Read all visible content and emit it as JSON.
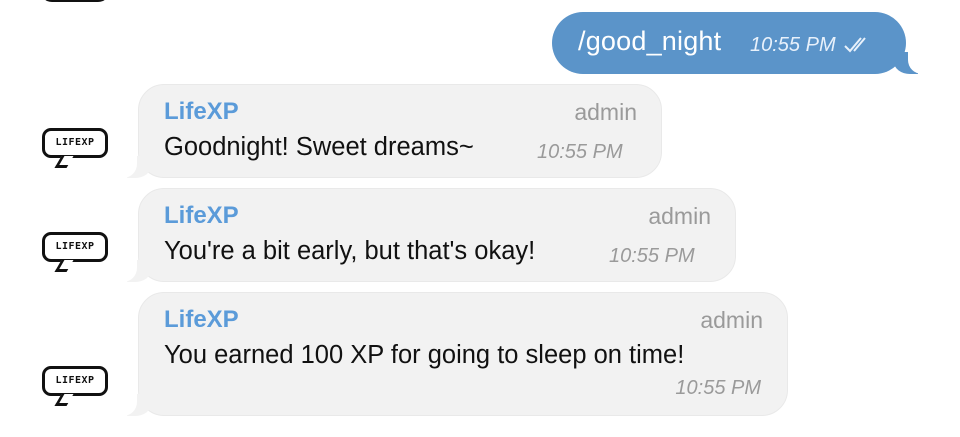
{
  "outgoing": {
    "text": "/good_night",
    "time": "10:55 PM",
    "status_icon": "double-check-icon"
  },
  "messages": [
    {
      "sender": "LifeXP",
      "role": "admin",
      "text": "Goodnight! Sweet dreams~",
      "time": "10:55 PM",
      "avatar_text": "LIFEXP"
    },
    {
      "sender": "LifeXP",
      "role": "admin",
      "text": "You're a bit early, but that's okay!",
      "time": "10:55 PM",
      "avatar_text": "LIFEXP"
    },
    {
      "sender": "LifeXP",
      "role": "admin",
      "text": "You earned 100 XP for going to sleep on time!",
      "time": "10:55 PM",
      "avatar_text": "LIFEXP"
    }
  ],
  "colors": {
    "outgoing_bubble": "#5b94c9",
    "incoming_bubble": "#f2f2f2",
    "sender_name": "#5b9bd9",
    "meta_text": "#9a9a9a"
  }
}
